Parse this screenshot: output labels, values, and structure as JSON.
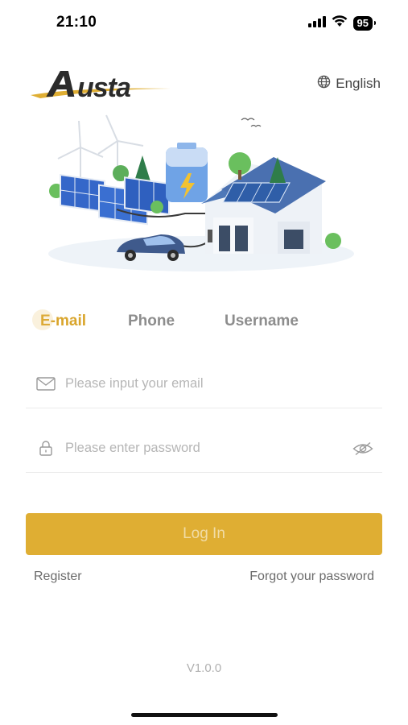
{
  "status_bar": {
    "time": "21:10",
    "battery": "95",
    "signal_icon": "cellular-signal-icon",
    "wifi_icon": "wifi-icon"
  },
  "header": {
    "logo_text": "Austa",
    "language": "English",
    "language_icon": "globe-icon"
  },
  "hero": {
    "image": "solar-house-illustration"
  },
  "tabs": [
    {
      "label": "E-mail",
      "active": true
    },
    {
      "label": "Phone",
      "active": false
    },
    {
      "label": "Username",
      "active": false
    }
  ],
  "form": {
    "email": {
      "value": "",
      "placeholder": "Please input your email",
      "icon": "envelope-icon"
    },
    "password": {
      "value": "",
      "placeholder": "Please enter password",
      "icon": "lock-icon",
      "toggle_icon": "eye-hidden-icon"
    },
    "login_label": "Log In"
  },
  "links": {
    "register": "Register",
    "forgot": "Forgot your password"
  },
  "footer": {
    "version": "V1.0.0"
  },
  "colors": {
    "accent": "#dfae33",
    "tab_active": "#d9a52c",
    "tab_inactive": "#8d8d8d",
    "placeholder": "#b6b6b6"
  }
}
